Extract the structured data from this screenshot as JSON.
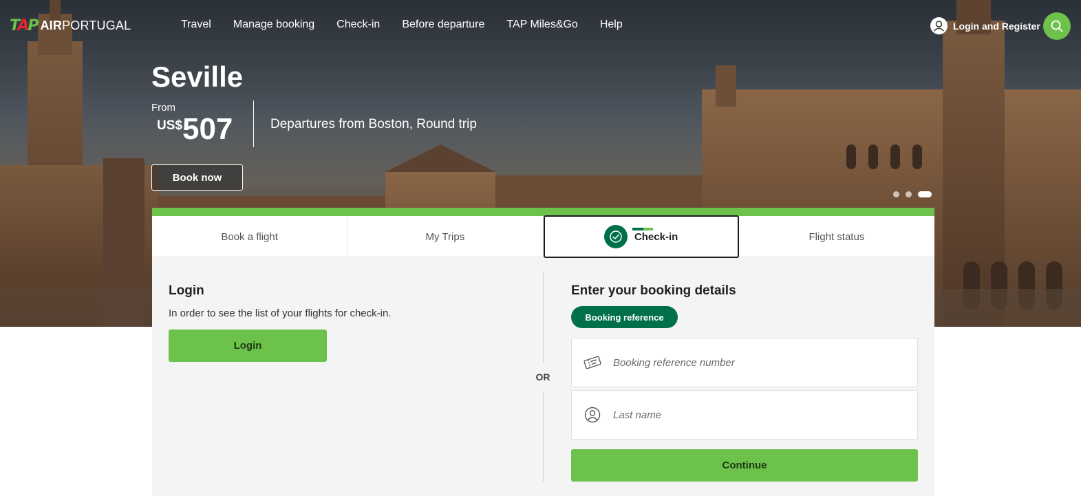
{
  "header": {
    "logo_mark": "TAP",
    "logo_text_bold": "AIR",
    "logo_text": "PORTUGAL",
    "nav": [
      "Travel",
      "Manage booking",
      "Check-in",
      "Before departure",
      "TAP Miles&Go",
      "Help"
    ],
    "login_label": "Login and Register",
    "icons": {
      "user": "user-circle-icon",
      "search": "search-icon"
    }
  },
  "promo": {
    "city": "Seville",
    "from_label": "From",
    "currency": "US$",
    "price": "507",
    "description": "Departures from Boston, Round trip",
    "cta": "Book now",
    "slide_count": 3,
    "active_slide": 3
  },
  "widget": {
    "tabs": [
      "Book a flight",
      "My Trips",
      "Check-in",
      "Flight status"
    ],
    "active_tab": "Check-in",
    "login": {
      "title": "Login",
      "text": "In order to see the list of your flights for check-in.",
      "button": "Login"
    },
    "or_label": "OR",
    "details": {
      "title": "Enter your booking details",
      "pill": "Booking reference",
      "booking_ref_placeholder": "Booking reference number",
      "last_name_placeholder": "Last name",
      "continue": "Continue"
    }
  },
  "colors": {
    "brand_green": "#6cc24a",
    "dark_green": "#00704a",
    "tap_red": "#e3262f"
  }
}
